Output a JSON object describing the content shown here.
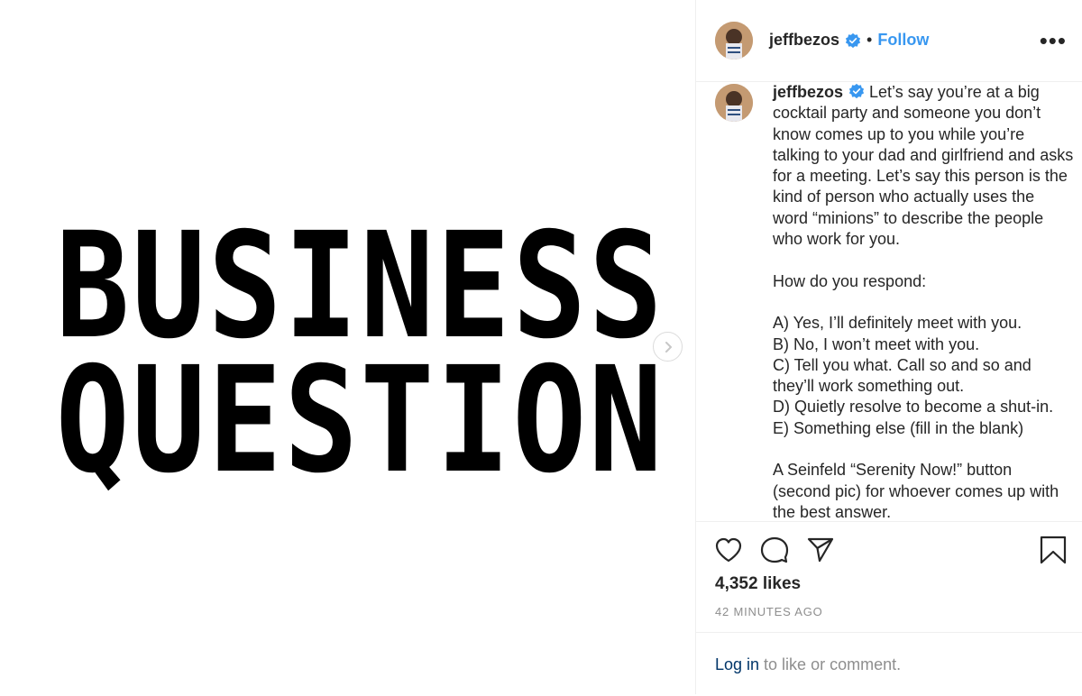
{
  "post": {
    "image_line1": "BUSINESS",
    "image_line2": "QUESTION"
  },
  "header": {
    "username": "jeffbezos",
    "separator": "•",
    "follow_label": "Follow",
    "more_label": "•••"
  },
  "caption": {
    "username": "jeffbezos",
    "text": " Let’s say you’re at a big cocktail party and someone you don’t know comes up to you while you’re talking to your dad and girlfriend and asks for a meeting. Let’s say this person is the kind of person who actually uses the word “minions” to describe the people who work for you.\n\nHow do you respond:\n\nA) Yes, I’ll definitely meet with you.\nB) No, I won’t meet with you.\nC) Tell you what. Call so and so and they’ll work something out.\nD) Quietly resolve to become a shut-in.\nE) Something else (fill in the blank)\n\nA Seinfeld “Serenity Now!” button (second pic) for whoever comes up with the best answer."
  },
  "stats": {
    "likes": "4,352 likes",
    "time_ago": "42 MINUTES AGO"
  },
  "login": {
    "link_label": "Log in",
    "rest": " to like or comment."
  },
  "icons": {
    "like": "heart-icon",
    "comment": "comment-icon",
    "share": "paper-plane-icon",
    "save": "bookmark-icon",
    "verified": "verified-badge-icon",
    "next": "chevron-right-icon"
  },
  "colors": {
    "link_blue": "#3897f0",
    "login_link": "#003569",
    "muted": "#8e8e8e",
    "text": "#262626"
  }
}
